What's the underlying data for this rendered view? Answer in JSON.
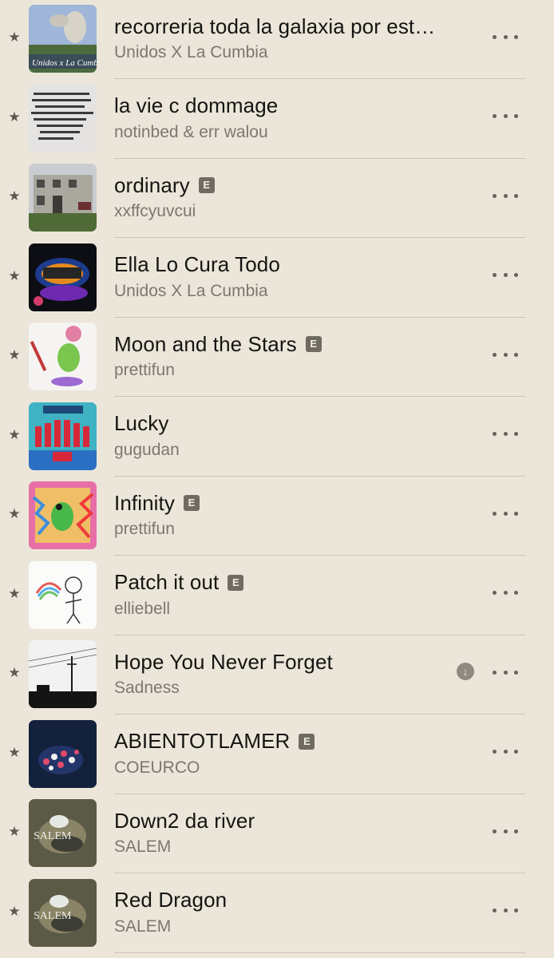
{
  "tracks": [
    {
      "title": "recorreria toda la galaxia por est…",
      "artist": "Unidos X La Cumbia",
      "explicit": false,
      "downloaded": false,
      "artwork_icon": "goat-space-cover",
      "artwork_text": "Unidos x La Cumbia"
    },
    {
      "title": "la vie c dommage",
      "artist": "notinbed & err walou",
      "explicit": false,
      "downloaded": false,
      "artwork_icon": "text-note-cover"
    },
    {
      "title": "ordinary",
      "artist": "xxffcyuvcui",
      "explicit": true,
      "downloaded": false,
      "artwork_icon": "house-photo-cover"
    },
    {
      "title": "Ella Lo Cura Todo",
      "artist": "Unidos X La Cumbia",
      "explicit": false,
      "downloaded": false,
      "artwork_icon": "neon-logo-cover"
    },
    {
      "title": "Moon and the Stars",
      "artist": "prettifun",
      "explicit": true,
      "downloaded": false,
      "artwork_icon": "green-creature-cover"
    },
    {
      "title": "Lucky",
      "artist": "gugudan",
      "explicit": false,
      "downloaded": false,
      "artwork_icon": "group-photo-cover"
    },
    {
      "title": "Infinity",
      "artist": "prettifun",
      "explicit": true,
      "downloaded": false,
      "artwork_icon": "colorful-creature-cover"
    },
    {
      "title": "Patch it out",
      "artist": "elliebell",
      "explicit": true,
      "downloaded": false,
      "artwork_icon": "sketch-drawing-cover"
    },
    {
      "title": "Hope You Never Forget",
      "artist": "Sadness",
      "explicit": false,
      "downloaded": true,
      "artwork_icon": "power-line-cover"
    },
    {
      "title": "ABIENTOTLAMER",
      "artist": "COEURCO",
      "explicit": true,
      "downloaded": false,
      "artwork_icon": "flowers-dark-cover"
    },
    {
      "title": "Down2 da river",
      "artist": "SALEM",
      "explicit": false,
      "downloaded": false,
      "artwork_icon": "salem-cover",
      "artwork_text": "SALEM"
    },
    {
      "title": "Red Dragon",
      "artist": "SALEM",
      "explicit": false,
      "downloaded": false,
      "artwork_icon": "salem-cover",
      "artwork_text": "SALEM"
    }
  ],
  "explicit_label": "E",
  "icons": {
    "star": "star-icon",
    "more": "more-icon",
    "download": "download-icon"
  },
  "colors": {
    "background": "#ebe6d9",
    "title": "#141412",
    "subtitle": "#7c786f",
    "separator": "#cac4b6"
  }
}
